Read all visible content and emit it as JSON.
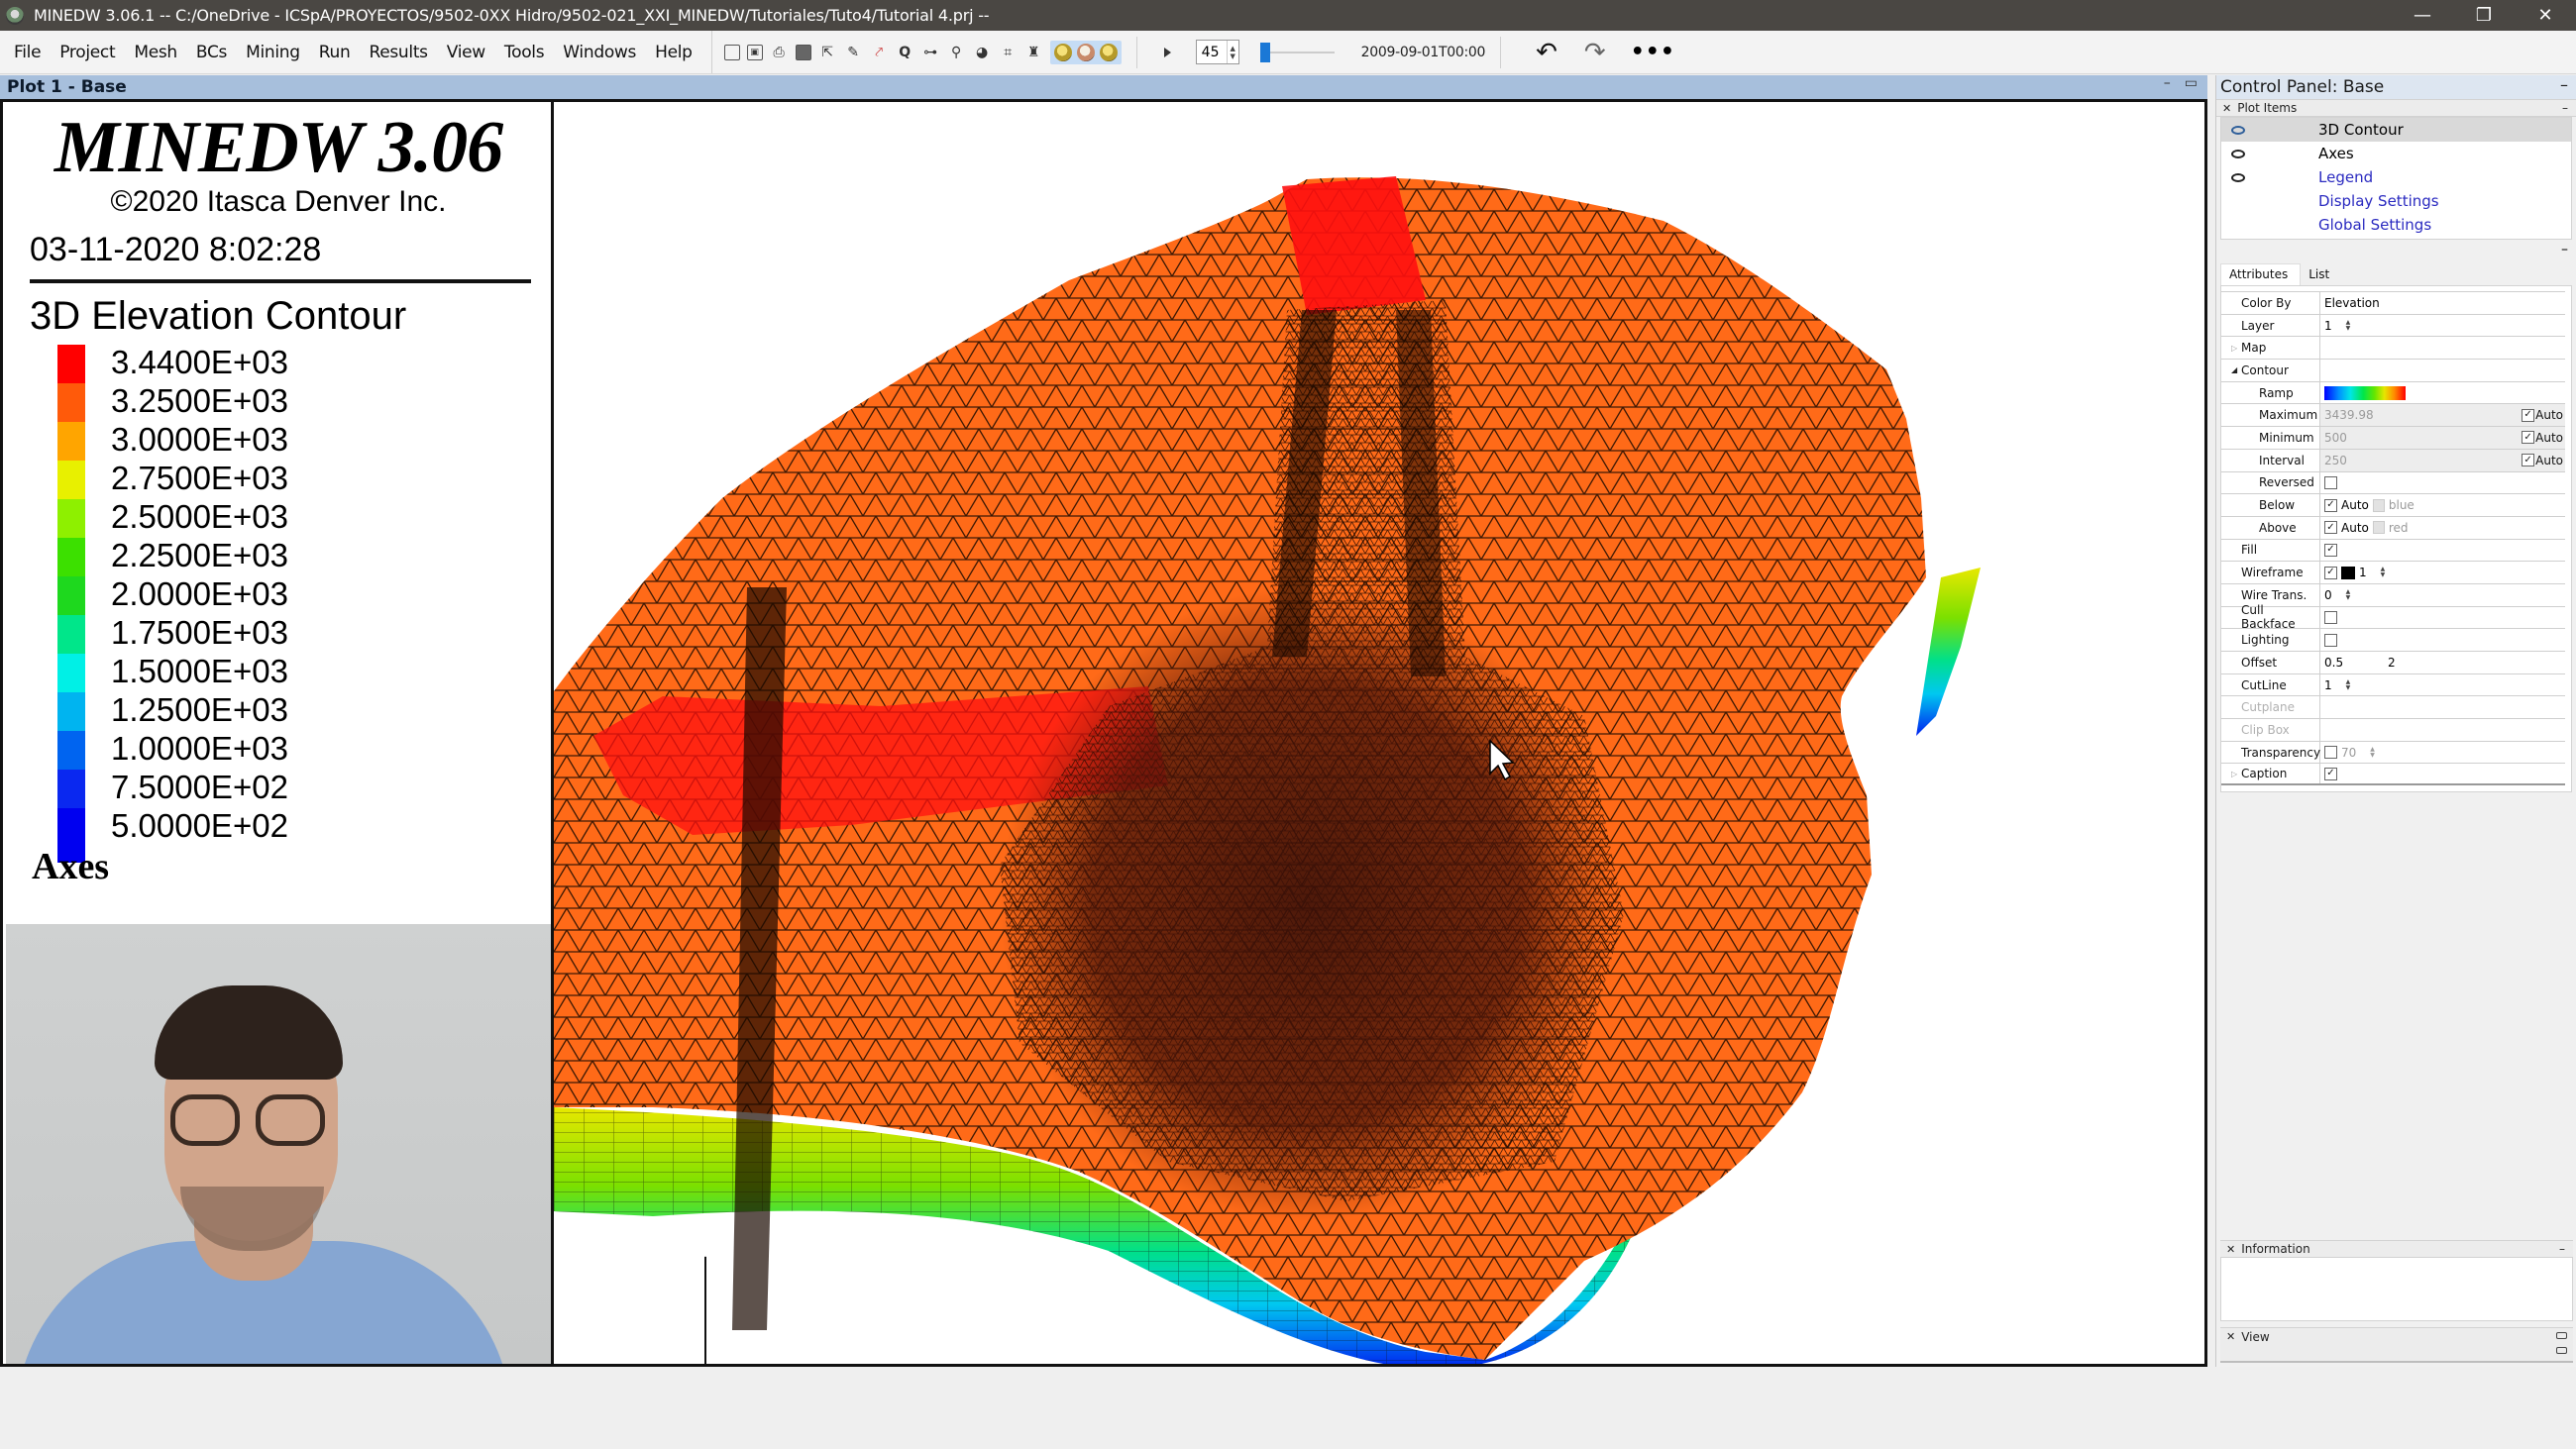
{
  "window": {
    "title": "MINEDW 3.06.1 -- C:/OneDrive - ICSpA/PROYECTOS/9502-0XX Hidro/9502-021_XXI_MINEDW/Tutoriales/Tuto4/Tutorial 4.prj --",
    "controls": {
      "minimize": "—",
      "restore": "❐",
      "close": "✕"
    }
  },
  "menu": [
    "File",
    "Project",
    "Mesh",
    "BCs",
    "Mining",
    "Run",
    "Results",
    "View",
    "Tools",
    "Windows",
    "Help"
  ],
  "toolbar": {
    "icons": [
      "new-file-icon",
      "open-icon",
      "print-icon",
      "save-icon",
      "select-pointer-icon",
      "pick-icon",
      "edge-select-icon",
      "zoom-icon",
      "link-icon",
      "network-icon",
      "globe-icon",
      "frame-icon",
      "stamp-icon"
    ],
    "highlighted_icons": [
      "view-top-icon",
      "view-side-icon",
      "view-iso-icon"
    ],
    "step_value": "45",
    "time_slider_fraction": 0.0,
    "time_label": "2009-09-01T00:00",
    "undo": "↶",
    "redo": "↷",
    "more": "•••"
  },
  "plot": {
    "header": "Plot 1 - Base",
    "header_controls": {
      "minimize": "–",
      "maximize": "▭"
    },
    "legend": {
      "brand": "MINEDW 3.06",
      "copyright": "©2020 Itasca Denver Inc.",
      "datetime": "03-11-2020 8:02:28",
      "contour_title": "3D Elevation Contour",
      "axes_label": "Axes"
    }
  },
  "chart_data": {
    "type": "heatmap",
    "title": "3D Elevation Contour",
    "variable": "Elevation",
    "levels": [
      {
        "label": "3.4400E+03",
        "value": 3440,
        "color": "#ff0000"
      },
      {
        "label": "3.2500E+03",
        "value": 3250,
        "color": "#ff5a0a"
      },
      {
        "label": "3.0000E+03",
        "value": 3000,
        "color": "#ffa500"
      },
      {
        "label": "2.7500E+03",
        "value": 2750,
        "color": "#e8f000"
      },
      {
        "label": "2.5000E+03",
        "value": 2500,
        "color": "#8ef000"
      },
      {
        "label": "2.2500E+03",
        "value": 2250,
        "color": "#3ce000"
      },
      {
        "label": "2.0000E+03",
        "value": 2000,
        "color": "#1ed81e"
      },
      {
        "label": "1.7500E+03",
        "value": 1750,
        "color": "#00e68a"
      },
      {
        "label": "1.5000E+03",
        "value": 1500,
        "color": "#00f0e6"
      },
      {
        "label": "1.2500E+03",
        "value": 1250,
        "color": "#00b4f0"
      },
      {
        "label": "1.0000E+03",
        "value": 1000,
        "color": "#0064f0"
      },
      {
        "label": "7.5000E+02",
        "value": 750,
        "color": "#0a28f0"
      },
      {
        "label": "5.0000E+02",
        "value": 500,
        "color": "#0000f0"
      }
    ],
    "range": [
      500,
      3439.98
    ],
    "interval": 250
  },
  "control_panel": {
    "title": "Control Panel: Base",
    "plot_items_header": "Plot Items",
    "plot_items": [
      {
        "label": "3D Contour",
        "visible": true,
        "selected": true,
        "link": false
      },
      {
        "label": "Axes",
        "visible": true,
        "selected": false,
        "link": false
      },
      {
        "label": "Legend",
        "visible": true,
        "selected": false,
        "link": true
      },
      {
        "label": "Display Settings",
        "visible": null,
        "selected": false,
        "link": true
      },
      {
        "label": "Global Settings",
        "visible": null,
        "selected": false,
        "link": true
      }
    ],
    "tabs": [
      "Attributes",
      "List"
    ],
    "attributes": {
      "color_by": {
        "label": "Color By",
        "value": "Elevation"
      },
      "layer": {
        "label": "Layer",
        "value": "1"
      },
      "map": {
        "label": "Map"
      },
      "contour": {
        "label": "Contour"
      },
      "ramp": {
        "label": "Ramp"
      },
      "maximum": {
        "label": "Maximum",
        "value": "3439.98",
        "auto": "Auto"
      },
      "minimum": {
        "label": "Minimum",
        "value": "500",
        "auto": "Auto"
      },
      "interval": {
        "label": "Interval",
        "value": "250",
        "auto": "Auto"
      },
      "reversed": {
        "label": "Reversed"
      },
      "below": {
        "label": "Below",
        "auto": "Auto",
        "color": "blue"
      },
      "above": {
        "label": "Above",
        "auto": "Auto",
        "color": "red"
      },
      "fill": {
        "label": "Fill"
      },
      "wireframe": {
        "label": "Wireframe",
        "value": "1"
      },
      "wire_trans": {
        "label": "Wire Trans.",
        "value": "0"
      },
      "cull_backface": {
        "label": "Cull Backface"
      },
      "lighting": {
        "label": "Lighting"
      },
      "offset": {
        "label": "Offset",
        "value1": "0.5",
        "value2": "2"
      },
      "cutline": {
        "label": "CutLine",
        "value": "1"
      },
      "cutplane": {
        "label": "Cutplane"
      },
      "clip_box": {
        "label": "Clip Box"
      },
      "transparency": {
        "label": "Transparency",
        "value": "70"
      },
      "caption": {
        "label": "Caption"
      }
    },
    "information_header": "Information",
    "view_header": "View"
  }
}
